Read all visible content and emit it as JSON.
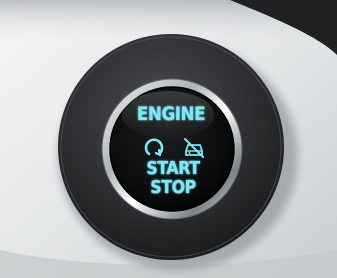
{
  "button": {
    "line1": "ENGINE",
    "line2": "START",
    "line3": "STOP",
    "icons": [
      "refresh-icon",
      "no-start-icon"
    ],
    "glow_color": "#7fe6f6"
  }
}
